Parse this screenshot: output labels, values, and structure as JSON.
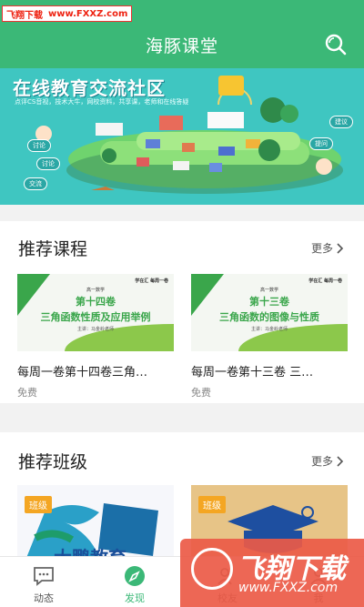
{
  "watermark_top": {
    "brand": "飞翔下载",
    "url": "www.FXXZ.com"
  },
  "header": {
    "title": "海豚课堂",
    "icon": "search-icon"
  },
  "banner": {
    "title": "在线教育交流社区",
    "subtitle": "点评CS音视，技术大牛，网校资料，共享课，老师和在线答疑",
    "tags": [
      "建议",
      "讨论",
      "交流",
      "提问",
      "讨论"
    ]
  },
  "recommend_courses": {
    "title": "推荐课程",
    "more": "更多",
    "items": [
      {
        "thumb_header": "学在汇 每周一卷",
        "thumb_sub": "高一数学",
        "thumb_volume": "第十四卷",
        "thumb_name": "三角函数性质及应用举例",
        "thumb_teacher": "主讲：马金岭老师",
        "title": "每周一卷第十四卷三角…",
        "price": "免费"
      },
      {
        "thumb_header": "学在汇 每周一卷",
        "thumb_sub": "高一数学",
        "thumb_volume": "第十三卷",
        "thumb_name": "三角函数的图像与性质",
        "thumb_teacher": "主讲：马金岭老师",
        "title": "每周一卷第十三卷 三…",
        "price": "免费"
      }
    ]
  },
  "recommend_classes": {
    "title": "推荐班级",
    "more": "更多",
    "items": [
      {
        "badge": "班级",
        "thumb_text": "大鹏教育"
      },
      {
        "badge": "班级"
      }
    ]
  },
  "nav": [
    {
      "label": "动态",
      "icon": "chat-bubble-icon",
      "active": false
    },
    {
      "label": "发现",
      "icon": "compass-icon",
      "active": true
    },
    {
      "label": "校友",
      "icon": "people-icon",
      "active": false
    },
    {
      "label": "我",
      "icon": "person-icon",
      "active": false
    }
  ],
  "watermark_bottom": {
    "brand": "飞翔下载",
    "url": "www.FXXZ.com"
  },
  "colors": {
    "primary": "#3bb877",
    "badge": "#f4a623",
    "banner": "#3fc6c1"
  }
}
